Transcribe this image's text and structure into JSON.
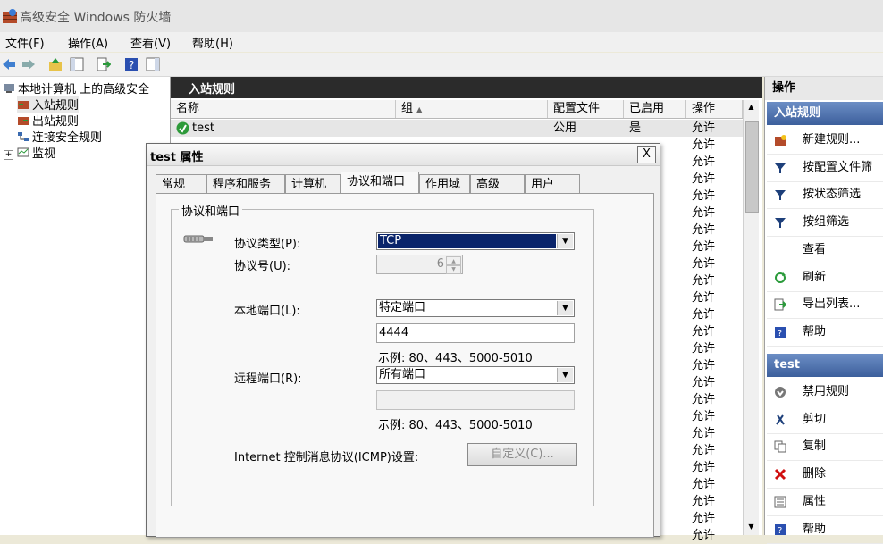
{
  "window": {
    "title": "高级安全 Windows 防火墙"
  },
  "menu": {
    "file": "文件(F)",
    "action": "操作(A)",
    "view": "查看(V)",
    "help": "帮助(H)"
  },
  "tree": {
    "root": "本地计算机 上的高级安全",
    "inbound": "入站规则",
    "outbound": "出站规则",
    "connsec": "连接安全规则",
    "monitor": "监视",
    "expand": "+"
  },
  "center": {
    "header": "入站规则",
    "columns": {
      "name": "名称",
      "group": "组",
      "profile": "配置文件",
      "enabled": "已启用",
      "action": "操作"
    },
    "sort_indicator": "▲",
    "first_row": {
      "name": "test",
      "profile": "公用",
      "enabled": "是",
      "action": "允许"
    },
    "action_values": [
      "允许",
      "允许",
      "允许",
      "允许",
      "允许",
      "允许",
      "允许",
      "允许",
      "允许",
      "允许",
      "允许",
      "允许",
      "允许",
      "允许",
      "允许",
      "允许",
      "允许",
      "允许",
      "允许",
      "允许",
      "允许",
      "允许",
      "允许",
      "允许"
    ]
  },
  "actions": {
    "header": "操作",
    "section1": "入站规则",
    "items1": [
      {
        "icon": "new-rule-icon",
        "label": "新建规则..."
      },
      {
        "icon": "filter-icon",
        "label": "按配置文件筛"
      },
      {
        "icon": "filter-icon",
        "label": "按状态筛选"
      },
      {
        "icon": "filter-icon",
        "label": "按组筛选"
      },
      {
        "icon": "none",
        "label": "查看"
      },
      {
        "icon": "refresh-icon",
        "label": "刷新"
      },
      {
        "icon": "export-icon",
        "label": "导出列表..."
      },
      {
        "icon": "help-icon",
        "label": "帮助"
      }
    ],
    "section2": "test",
    "items2": [
      {
        "icon": "disable-icon",
        "label": "禁用规则"
      },
      {
        "icon": "cut-icon",
        "label": "剪切"
      },
      {
        "icon": "copy-icon",
        "label": "复制"
      },
      {
        "icon": "delete-icon",
        "label": "删除"
      },
      {
        "icon": "properties-icon",
        "label": "属性"
      },
      {
        "icon": "help-icon",
        "label": "帮助"
      }
    ]
  },
  "dialog": {
    "title": "test 属性",
    "close": "X",
    "tabs": [
      "常规",
      "程序和服务",
      "计算机",
      "协议和端口",
      "作用域",
      "高级",
      "用户"
    ],
    "selected_tab": "协议和端口",
    "group_title": "协议和端口",
    "protocol_type_label": "协议类型(P):",
    "protocol_type_value": "TCP",
    "protocol_number_label": "协议号(U):",
    "protocol_number_value": "6",
    "local_port_label": "本地端口(L):",
    "local_port_value": "特定端口",
    "local_port_input": "4444",
    "local_example": "示例: 80、443、5000-5010",
    "remote_port_label": "远程端口(R):",
    "remote_port_value": "所有端口",
    "remote_port_input": "",
    "remote_example": "示例: 80、443、5000-5010",
    "icmp_label": "Internet 控制消息协议(ICMP)设置:",
    "customize_button": "自定义(C)..."
  },
  "colors": {
    "accent": "#0a246a",
    "section_header": "#4a6ea9",
    "center_header": "#2b2b2b"
  }
}
